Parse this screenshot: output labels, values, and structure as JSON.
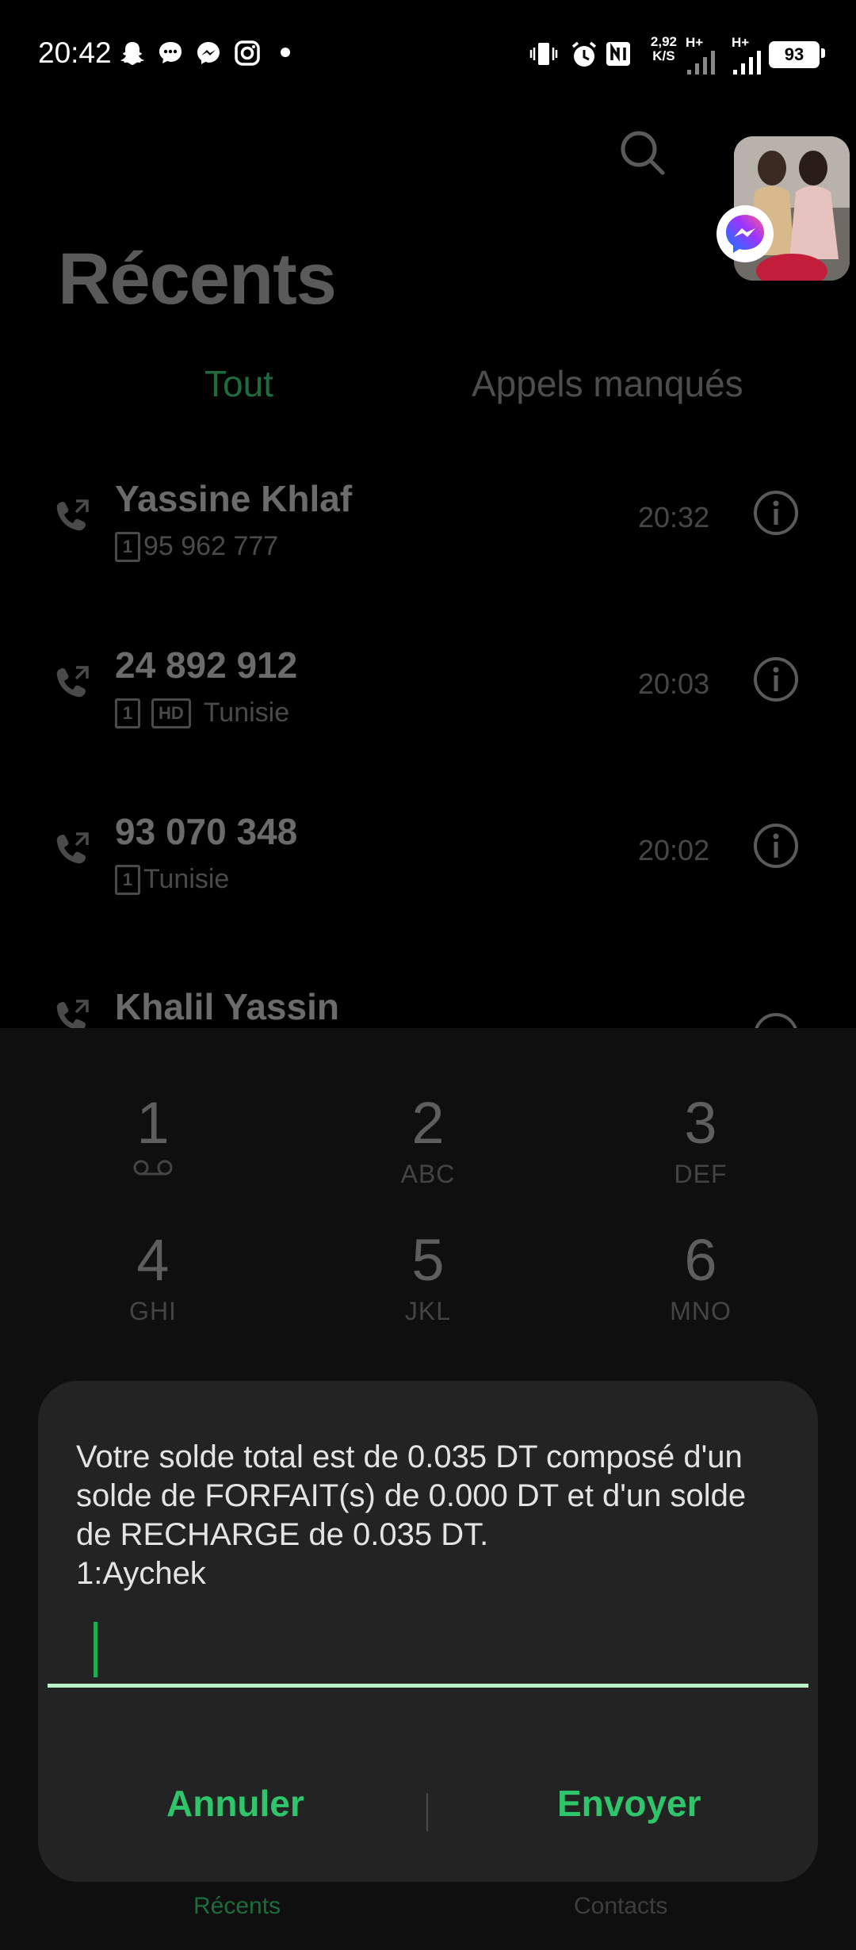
{
  "status_bar": {
    "time": "20:42",
    "net_speed_value": "2,92",
    "net_speed_unit": "K/S",
    "signal1_label": "H+",
    "signal2_label": "H+",
    "battery": "93",
    "left_icons": [
      "snapchat-icon",
      "message-icon",
      "messenger-icon",
      "instagram-icon",
      "dot-icon"
    ],
    "right_icons": [
      "vibrate-icon",
      "alarm-icon",
      "nfc-icon",
      "signal-icon",
      "signal-icon",
      "battery-icon"
    ]
  },
  "header": {
    "title": "Récents",
    "search_icon": "search-icon"
  },
  "tabs": [
    {
      "label": "Tout",
      "active": true
    },
    {
      "label": "Appels manqués",
      "active": false
    }
  ],
  "calls": [
    {
      "name": "Yassine Khlaf",
      "sim": "1",
      "hd": false,
      "detail": "95 962 777",
      "time": "20:32"
    },
    {
      "name": "24 892 912",
      "sim": "1",
      "hd": true,
      "hd_label": "HD",
      "detail": "Tunisie",
      "time": "20:03"
    },
    {
      "name": "93 070 348",
      "sim": "1",
      "hd": false,
      "detail": "Tunisie",
      "time": "20:02"
    },
    {
      "name": "Khalil Yassin",
      "sim": "",
      "hd": false,
      "detail": "",
      "time": ""
    }
  ],
  "dialpad": {
    "keys": [
      {
        "digit": "1",
        "letters": ""
      },
      {
        "digit": "2",
        "letters": "ABC"
      },
      {
        "digit": "3",
        "letters": "DEF"
      },
      {
        "digit": "4",
        "letters": "GHI"
      },
      {
        "digit": "5",
        "letters": "JKL"
      },
      {
        "digit": "6",
        "letters": "MNO"
      }
    ]
  },
  "bottom_nav": {
    "recents": "Récents",
    "contacts": "Contacts"
  },
  "dialog": {
    "message": "Votre solde total est de 0.035 DT composé d'un solde de FORFAIT(s) de 0.000 DT et d'un solde de RECHARGE de 0.035 DT.\n1:Aychek",
    "input_value": "",
    "cancel_label": "Annuler",
    "send_label": "Envoyer"
  },
  "colors": {
    "accent": "#2fc56b",
    "dialog_bg": "#232323",
    "underline": "#b9f2c9"
  }
}
